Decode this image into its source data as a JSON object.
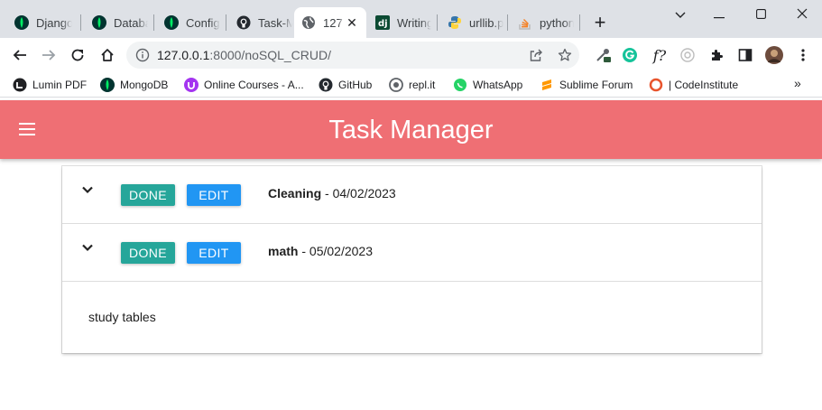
{
  "browser": {
    "tabs": [
      {
        "title": "Django",
        "icon": "mongodb-leaf-icon"
      },
      {
        "title": "Databa",
        "icon": "mongodb-leaf-icon"
      },
      {
        "title": "Config",
        "icon": "mongodb-leaf-icon"
      },
      {
        "title": "Task-M",
        "icon": "github-icon"
      },
      {
        "title": "127",
        "icon": "globe-icon",
        "active": true
      },
      {
        "title": "Writing",
        "icon": "django-icon"
      },
      {
        "title": "urllib.p",
        "icon": "python-icon"
      },
      {
        "title": "python",
        "icon": "stackoverflow-icon"
      }
    ],
    "window_controls": {
      "minimize": "⌄",
      "min": "—",
      "restore": "☐",
      "close": "✕"
    },
    "address": {
      "host": "127.0.0.1",
      "path": ":8000/noSQL_CRUD/"
    },
    "bookmarks": [
      {
        "label": "Lumin PDF",
        "icon": "lumin-icon"
      },
      {
        "label": "MongoDB",
        "icon": "mongodb-leaf-icon"
      },
      {
        "label": "Online Courses - A...",
        "icon": "udemy-icon"
      },
      {
        "label": "GitHub",
        "icon": "github-icon"
      },
      {
        "label": "repl.it",
        "icon": "replit-icon"
      },
      {
        "label": "WhatsApp",
        "icon": "whatsapp-icon"
      },
      {
        "label": "Sublime Forum",
        "icon": "sublime-icon"
      },
      {
        "label": "| CodeInstitute",
        "icon": "codeinstitute-icon"
      }
    ],
    "bookmarks_more": "»"
  },
  "app": {
    "title": "Task Manager",
    "header_color": "#ef6f74",
    "done_label": "DONE",
    "edit_label": "EDIT",
    "done_color": "#26a69a",
    "edit_color": "#2196f3",
    "tasks": [
      {
        "name": "Cleaning",
        "separator": " - ",
        "date": "04/02/2023"
      },
      {
        "name": "math",
        "separator": " - ",
        "date": "05/02/2023",
        "description": "study tables",
        "expanded": true
      }
    ]
  }
}
